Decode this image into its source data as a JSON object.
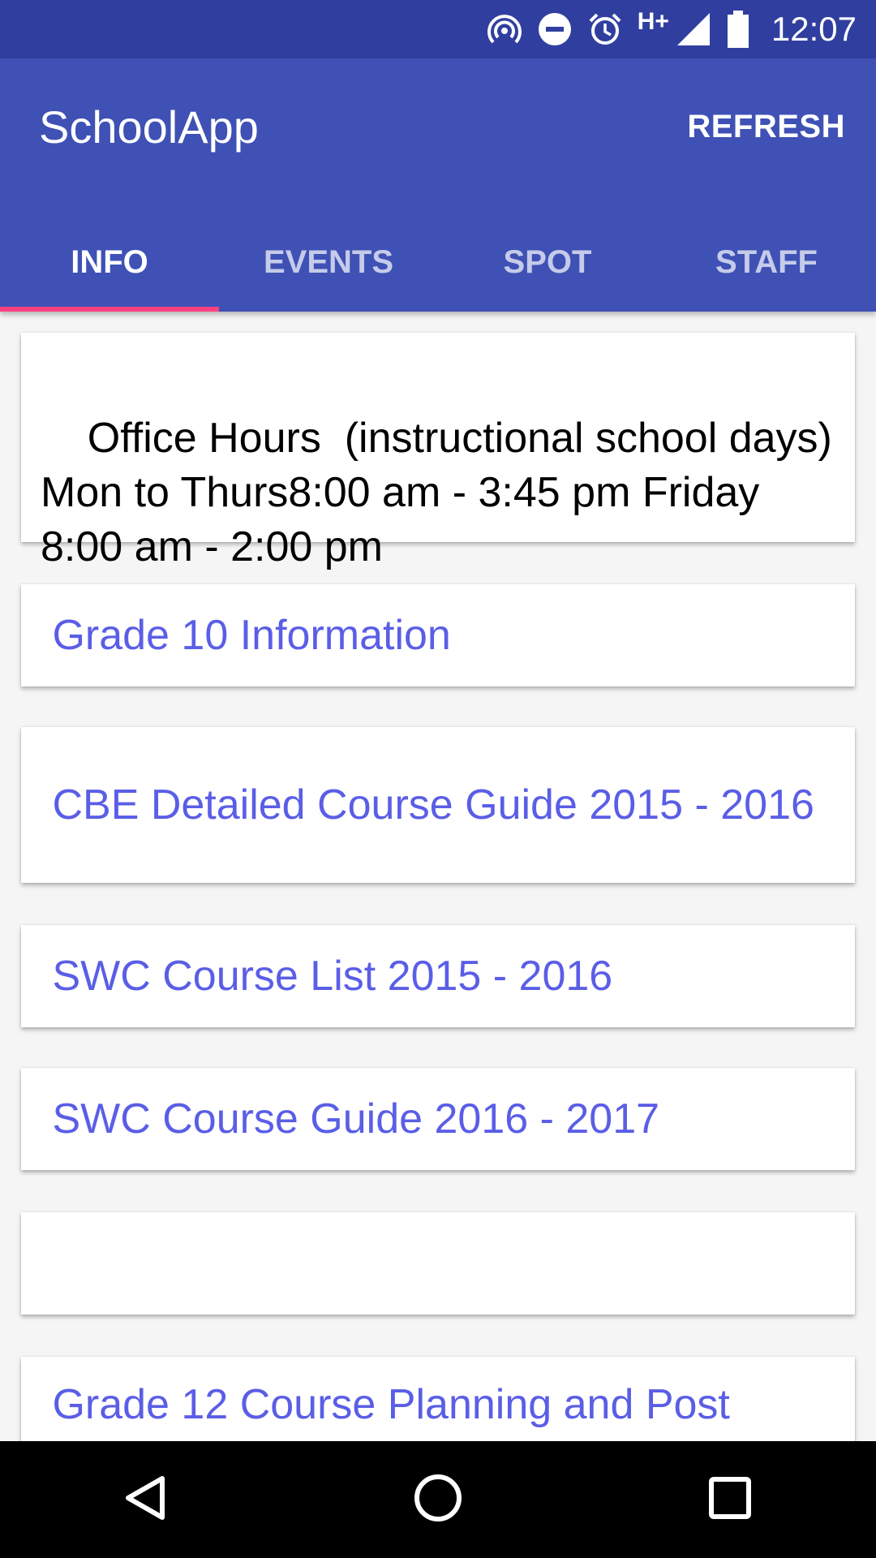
{
  "status_bar": {
    "time": "12:07",
    "network_label": "H+",
    "icons": [
      "hotspot-icon",
      "do-not-disturb-icon",
      "alarm-icon",
      "signal-icon",
      "battery-icon"
    ]
  },
  "app_bar": {
    "title": "SchoolApp",
    "refresh_label": "REFRESH"
  },
  "tabs": [
    {
      "label": "INFO",
      "active": true
    },
    {
      "label": "EVENTS",
      "active": false
    },
    {
      "label": "SPOT",
      "active": false
    },
    {
      "label": "STAFF",
      "active": false
    }
  ],
  "content": {
    "info_text": "Office Hours  (instructional school days) Mon to Thurs8:00 am - 3:45 pm Friday 8:00 am - 2:00 pm",
    "links": [
      " Grade 10 Information",
      " CBE Detailed Course Guide 2015 - 2016",
      " SWC Course List 2015 - 2016",
      " SWC Course Guide 2016 - 2017",
      "",
      " Grade 12 Course Planning and Post"
    ]
  },
  "colors": {
    "status_bar": "#303f9f",
    "primary": "#3f51b5",
    "tab_indicator": "#ff4081",
    "link": "#5a5ee6",
    "background": "#f5f5f5"
  },
  "nav_bar": {
    "icons": [
      "back-icon",
      "home-icon",
      "recents-icon"
    ]
  }
}
